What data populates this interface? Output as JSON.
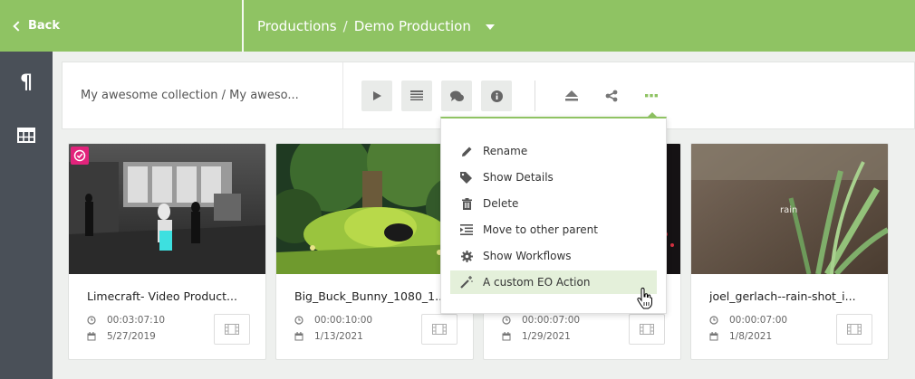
{
  "header": {
    "back_label": "Back",
    "crumb_root": "Productions",
    "crumb_separator": "/",
    "crumb_current": "Demo Production"
  },
  "toolbar": {
    "collection_title": "My awesome collection / My aweso..."
  },
  "menu": {
    "items": [
      {
        "label": "Rename",
        "icon": "pencil-icon"
      },
      {
        "label": "Show Details",
        "icon": "tags-icon"
      },
      {
        "label": "Delete",
        "icon": "trash-icon"
      },
      {
        "label": "Move to other parent",
        "icon": "indent-icon"
      },
      {
        "label": "Show Workflows",
        "icon": "gear-icon"
      },
      {
        "label": "A custom EO Action",
        "icon": "magic-wand-icon",
        "highlighted": true
      }
    ]
  },
  "cards": [
    {
      "title": "Limecraft- Video Product...",
      "duration": "00:03:07:10",
      "date": "5/27/2019",
      "selected": true
    },
    {
      "title": "Big_Buck_Bunny_1080_1...",
      "duration": "00:00:10:00",
      "date": "1/13/2021"
    },
    {
      "title": "",
      "duration": "00:00:07:00",
      "date": "1/29/2021"
    },
    {
      "title": "joel_gerlach--rain-shot_i...",
      "duration": "00:00:07:00",
      "date": "1/8/2021",
      "thumb_overlay": "rain"
    }
  ],
  "colors": {
    "accent": "#8fc363",
    "rail": "#4a5058",
    "selected_badge": "#e2237b",
    "highlight": "#e4f0da"
  }
}
